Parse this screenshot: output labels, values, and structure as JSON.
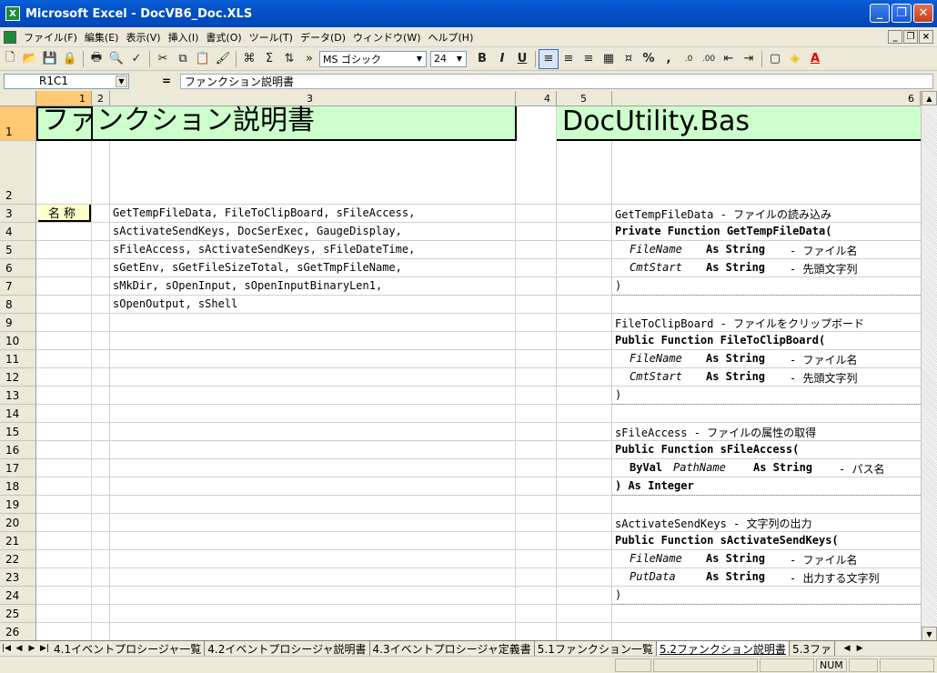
{
  "window": {
    "title": "Microsoft Excel - DocVB6_Doc.XLS",
    "app_icon_label": "X",
    "controls": {
      "minimize": "_",
      "restore": "❐",
      "close": "✕"
    }
  },
  "menubar": {
    "items": [
      "ファイル(F)",
      "編集(E)",
      "表示(V)",
      "挿入(I)",
      "書式(O)",
      "ツール(T)",
      "データ(D)",
      "ウィンドウ(W)",
      "ヘルプ(H)"
    ],
    "mdi_controls": {
      "minimize": "_",
      "restore": "❐",
      "close": "×"
    }
  },
  "toolbar": {
    "font_name": "MS ゴシック",
    "font_size": "24",
    "bold": "B",
    "italic": "I",
    "underline": "U",
    "percent": "%",
    "comma": ",",
    "sum": "Σ"
  },
  "formula_bar": {
    "name_box": "R1C1",
    "fx": "=",
    "value": "ファンクション説明書"
  },
  "columns": [
    "1",
    "2",
    "3",
    "4",
    "5",
    "6"
  ],
  "rows": [
    "1",
    "2",
    "3",
    "4",
    "5",
    "6",
    "7",
    "8",
    "9",
    "10",
    "11",
    "12",
    "13",
    "14",
    "15",
    "16",
    "17",
    "18",
    "19",
    "20",
    "21",
    "22",
    "23",
    "24",
    "25",
    "26"
  ],
  "sheet": {
    "title_left": "ファンクション説明書",
    "title_right": "DocUtility.Bas",
    "name_label": "名称",
    "function_list": [
      "GetTempFileData, FileToClipBoard, sFileAccess,",
      "sActivateSendKeys, DocSerExec, GaugeDisplay,",
      "sFileAccess, sActivateSendKeys, sFileDateTime,",
      "sGetEnv, sGetFileSizeTotal, sGetTmpFileName,",
      "sMkDir, sOpenInput, sOpenInputBinaryLen1,",
      "sOpenOutput, sShell"
    ],
    "blocks": [
      {
        "header": "GetTempFileData - ファイルの読み込み",
        "signature": "Private Function GetTempFileData(",
        "params": [
          {
            "prefix": "",
            "name": "FileName",
            "type": "As String",
            "desc": "- ファイル名"
          },
          {
            "prefix": "",
            "name": "CmtStart",
            "type": "As String",
            "desc": "- 先頭文字列"
          }
        ],
        "close": ")"
      },
      {
        "header": "FileToClipBoard - ファイルをクリップボード",
        "signature": "Public Function FileToClipBoard(",
        "params": [
          {
            "prefix": "",
            "name": "FileName",
            "type": "As String",
            "desc": "- ファイル名"
          },
          {
            "prefix": "",
            "name": "CmtStart",
            "type": "As String",
            "desc": "- 先頭文字列"
          }
        ],
        "close": ")"
      },
      {
        "header": "sFileAccess - ファイルの属性の取得",
        "signature": "Public Function sFileAccess(",
        "params": [
          {
            "prefix": "ByVal",
            "name": "PathName",
            "type": "As String",
            "desc": "- パス名"
          }
        ],
        "close": ") As Integer"
      },
      {
        "header": "sActivateSendKeys - 文字列の出力",
        "signature": "Public Function sActivateSendKeys(",
        "params": [
          {
            "prefix": "",
            "name": "FileName",
            "type": "As String",
            "desc": "- ファイル名"
          },
          {
            "prefix": "",
            "name": "PutData",
            "type": "As String",
            "desc": "- 出力する文字列"
          }
        ],
        "close": ")"
      }
    ]
  },
  "tabs": [
    "4.1イベントプロシージャ一覧",
    "4.2イベントプロシージャ説明書",
    "4.3イベントプロシージャ定義書",
    "5.1ファンクション一覧",
    "5.2ファンクション説明書",
    "5.3ファ"
  ],
  "active_tab_index": 4,
  "status": {
    "num": "NUM"
  },
  "colors": {
    "title_fill": "#ccffcc",
    "name_fill": "#ffffcc",
    "titlebar": "#0350c8"
  }
}
